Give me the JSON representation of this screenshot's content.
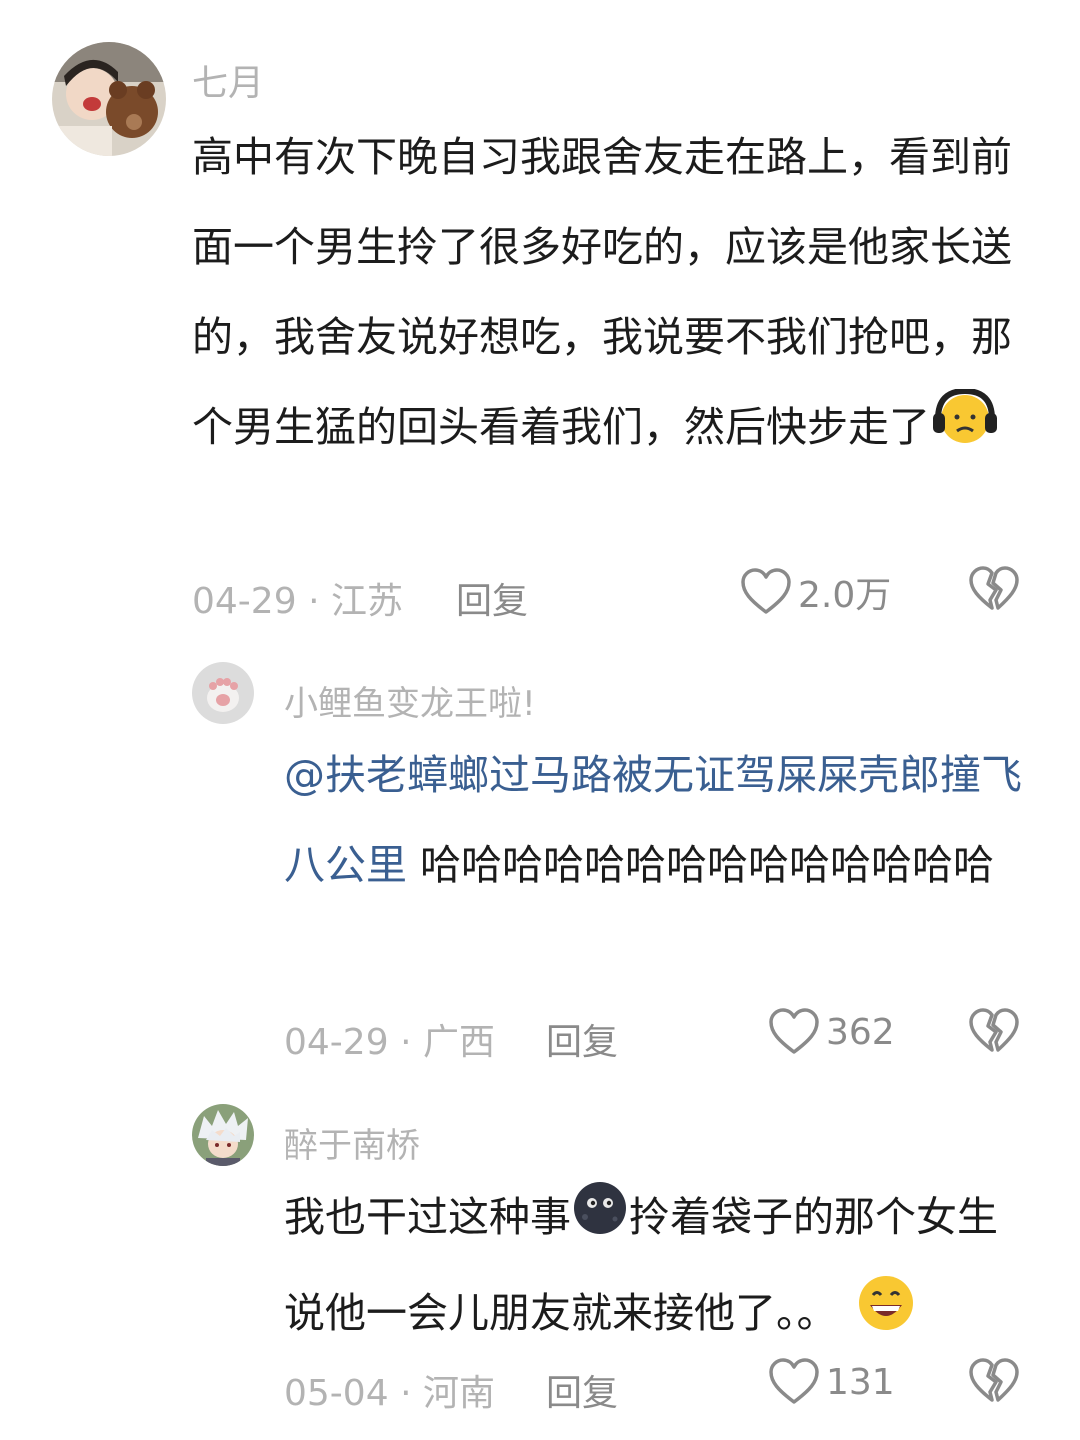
{
  "comments": [
    {
      "username": "七月",
      "text": "高中有次下晚自习我跟舍友走在路上，看到前面一个男生拎了很多好吃的，应该是他家长送的，我舍友说好想吃，我说要不我们抢吧，那个男生猛的回头看着我们，然后快步走了",
      "emoji": "headphones-face-emoji",
      "date": "04-29",
      "separator": "·",
      "location": "江苏",
      "reply_label": "回复",
      "likes": "2.0万"
    },
    {
      "username": "小鲤鱼变龙王啦!",
      "mention": "@扶老蟑螂过马路被无证驾屎屎壳郎撞飞八公里",
      "text": " 哈哈哈哈哈哈哈哈哈哈哈哈哈哈",
      "date": "04-29",
      "separator": "·",
      "location": "广西",
      "reply_label": "回复",
      "likes": "362"
    },
    {
      "username": "醉于南桥",
      "text_before": "我也干过这种事",
      "text_after": "拎着袋子的那个女生说他一会儿朋友就来接他了。。",
      "emoji_mid": "dark-moon-face-emoji",
      "emoji_end": "grinning-face-emoji",
      "date": "05-04",
      "separator": "·",
      "location": "河南",
      "reply_label": "回复",
      "likes": "131"
    }
  ],
  "colors": {
    "mention": "#3a5f91",
    "meta": "#b3b3b3",
    "icon": "#8a8a8a"
  }
}
